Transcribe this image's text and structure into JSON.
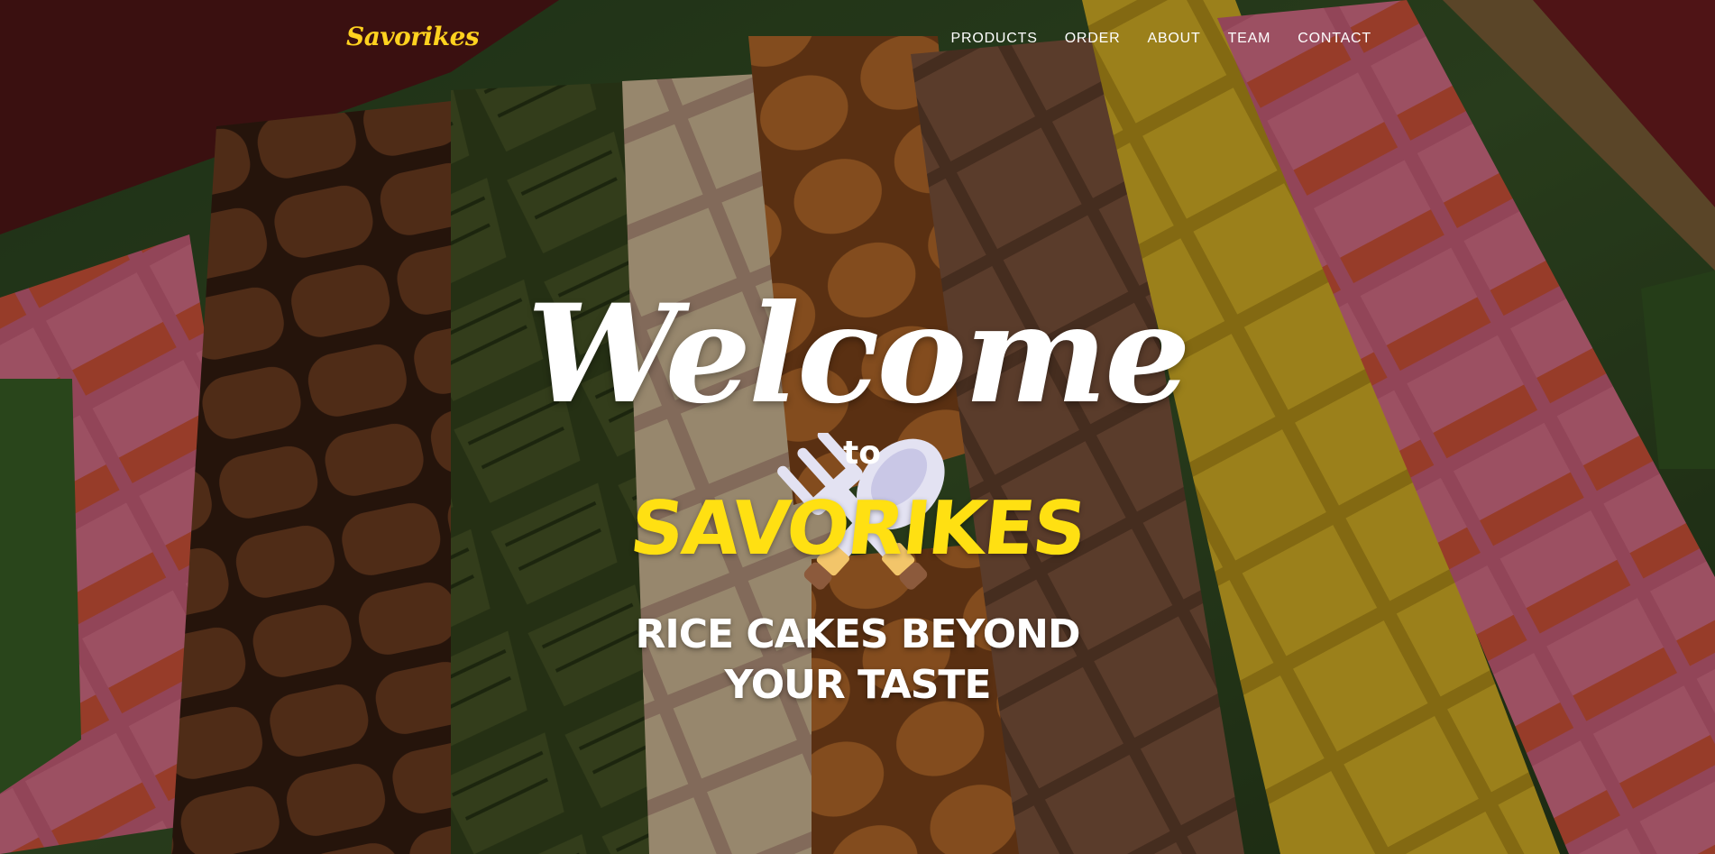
{
  "navbar": {
    "brand": "Savorikes",
    "links": [
      "PRODUCTS",
      "ORDER",
      "ABOUT",
      "TEAM",
      "CONTACT"
    ]
  },
  "hero": {
    "welcome": "Welcome",
    "to": "to",
    "brand_name": "SAVORIKES",
    "tagline_line1": "RICE CAKES BEYOND",
    "tagline_line2": "YOUR TASTE",
    "background_image": "assorted-rice-cakes-on-banana-leaf",
    "icon": "fork-and-spoon-icon"
  },
  "colors": {
    "brand_yellow": "#ffd21f",
    "headline_white": "#ffffff",
    "overlay": "rgba(0,0,0,0.35)"
  }
}
